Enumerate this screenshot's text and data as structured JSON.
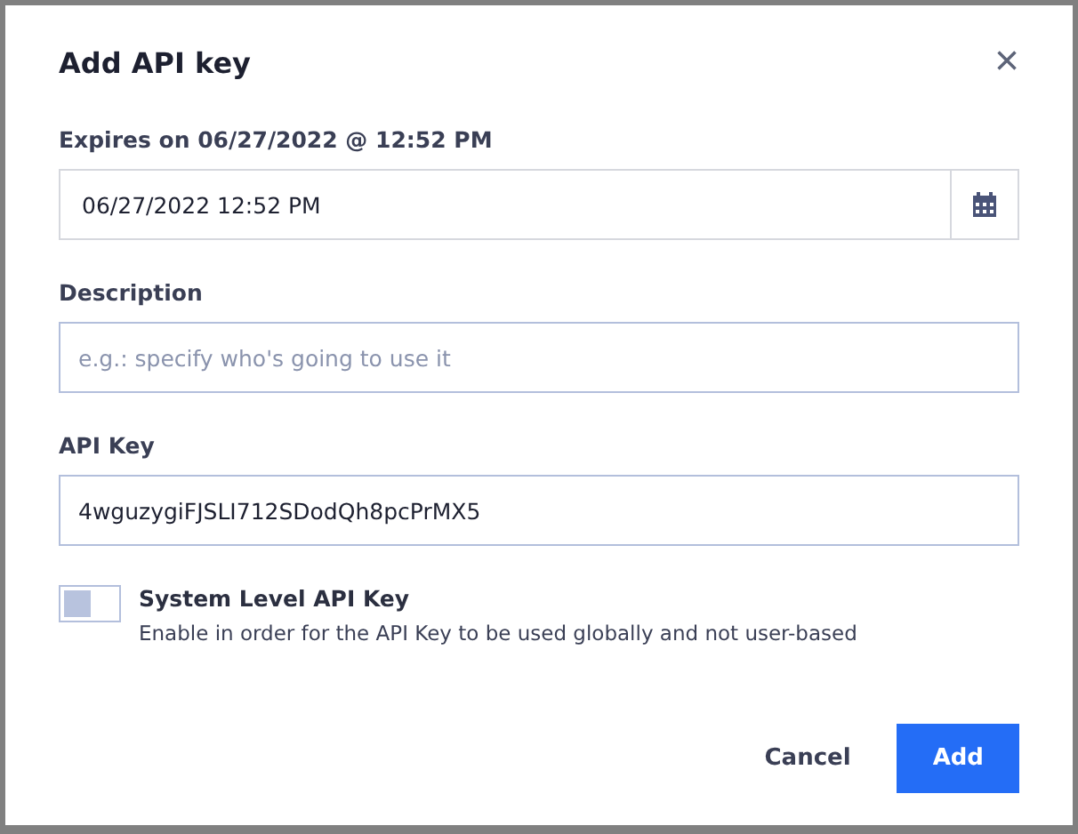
{
  "dialog": {
    "title": "Add API key",
    "close": "×"
  },
  "expires": {
    "label": "Expires on 06/27/2022 @ 12:52 PM",
    "value": "06/27/2022 12:52 PM"
  },
  "description": {
    "label": "Description",
    "placeholder": "e.g.: specify who's going to use it"
  },
  "api_key": {
    "label": "API Key",
    "value": "4wguzygiFJSLI712SDodQh8pcPrMX5"
  },
  "system_level": {
    "label": "System Level API Key",
    "hint": "Enable in order for the API Key to be used globally and not user-based",
    "on": false
  },
  "buttons": [
    {
      "label": "Cancel",
      "kind": "secondary"
    },
    {
      "label": "Add",
      "kind": "primary"
    }
  ]
}
